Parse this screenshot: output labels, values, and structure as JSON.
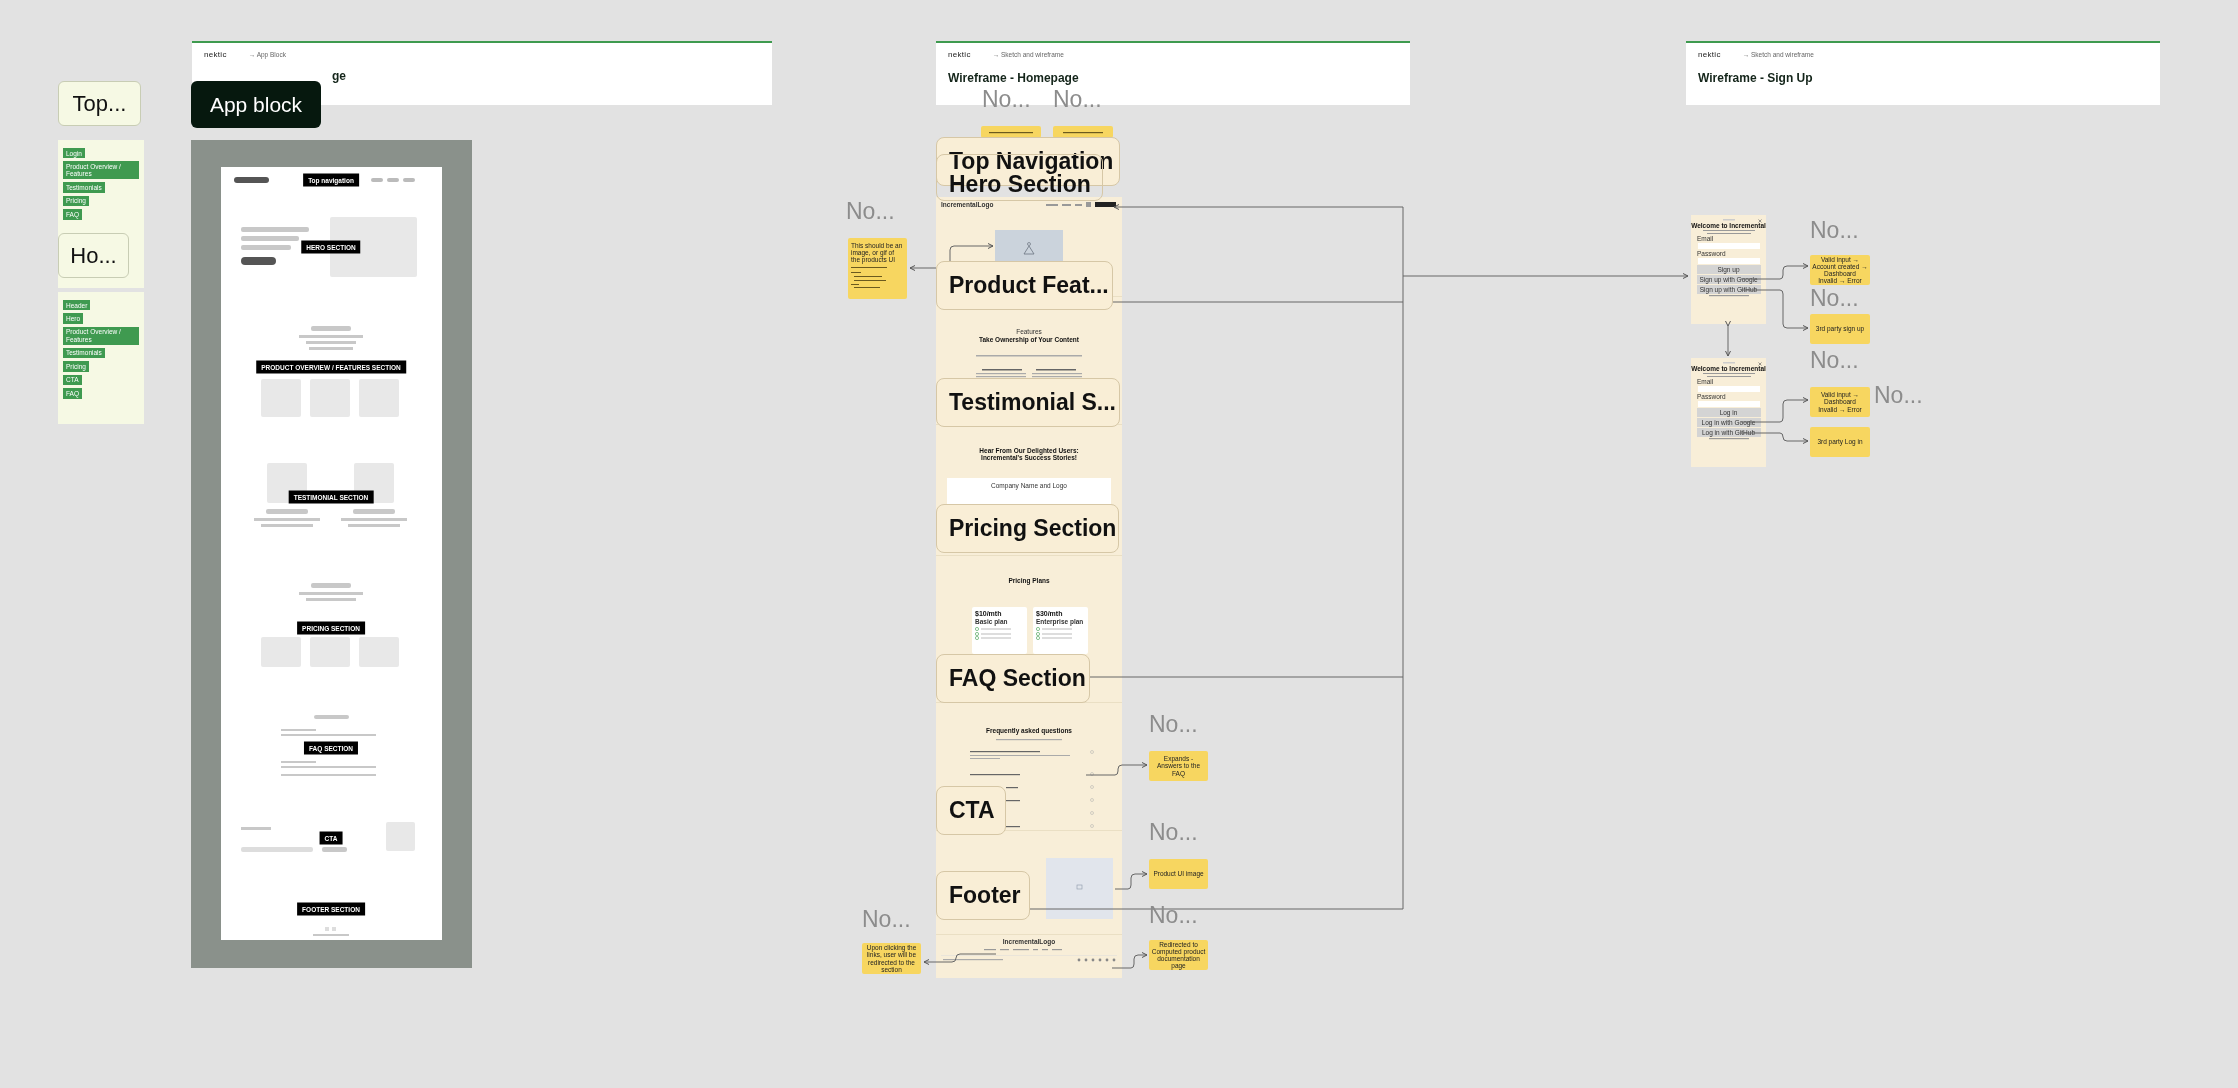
{
  "frames": [
    {
      "logo": "nektic",
      "breadcrumb": "→ App Block",
      "title": "ge"
    },
    {
      "logo": "nektic",
      "breadcrumb": "→ Sketch and wireframe",
      "title": "Wireframe - Homepage"
    },
    {
      "logo": "nektic",
      "breadcrumb": "→ Sketch and wireframe",
      "title": "Wireframe - Sign Up"
    }
  ],
  "app_block_tag": "App block",
  "group_labels": [
    "Top...",
    "Ho..."
  ],
  "tag_lists": [
    [
      "Login",
      "Product Overview / Features",
      "Testimonials",
      "Pricing",
      "FAQ"
    ],
    [
      "Header",
      "Hero",
      "Product Overview / Features",
      "Testimonials",
      "Pricing",
      "CTA",
      "FAQ"
    ]
  ],
  "app_block_sections": [
    "Top navigation",
    "HERO SECTION",
    "PRODUCT OVERVIEW / FEATURES SECTION",
    "TESTIMONIAL SECTION",
    "PRICING SECTION",
    "FAQ SECTION",
    "CTA",
    "FOOTER SECTION"
  ],
  "homepage": {
    "logo": "IncrementalLogo",
    "features_eyebrow": "Features",
    "features_title": "Take Ownership of Your Content",
    "testimonials_title": "Hear From Our Delighted Users: Incremental's Success Stories!",
    "company_label": "Company Name and Logo",
    "pricing_title": "Pricing Plans",
    "plans": [
      {
        "price": "$10/mth",
        "name": "Basic plan"
      },
      {
        "price": "$30/mth",
        "name": "Enterprise plan"
      }
    ],
    "faq_title": "Frequently asked questions",
    "footer_logo": "IncrementalLogo"
  },
  "section_labels": [
    "Top Navigation",
    "Hero Section",
    "Product Feat...",
    "Testimonial S...",
    "Pricing Section",
    "FAQ Section",
    "CTA",
    "Footer"
  ],
  "note_titles": [
    "No...",
    "No...",
    "No...",
    "No...",
    "No...",
    "No...",
    "No...",
    "No...",
    "No...",
    "No...",
    "No..."
  ],
  "notes": [
    "This should be an image, or gif of the products UI",
    "Expands - Answers to the FAQ",
    "Product UI image",
    "Upon clicking the links, user will be redirected to the section",
    "Redirected to Computed product documentation page",
    "Valid input → Account created → Dashboard\nInvalid → Error",
    "3rd party sign up",
    "Valid input → Dashboard\nInvalid → Error",
    "3rd party Log in"
  ],
  "signup_cards": [
    {
      "title": "Welcome to Incremental",
      "email_label": "Email",
      "password_label": "Password",
      "primary": "Sign up",
      "google": "Sign up with Google",
      "github": "Sign up with GitHub"
    },
    {
      "title": "Welcome to Incremental",
      "email_label": "Email",
      "password_label": "Password",
      "primary": "Log in",
      "google": "Log in with Google",
      "github": "Log in with GitHub"
    }
  ]
}
